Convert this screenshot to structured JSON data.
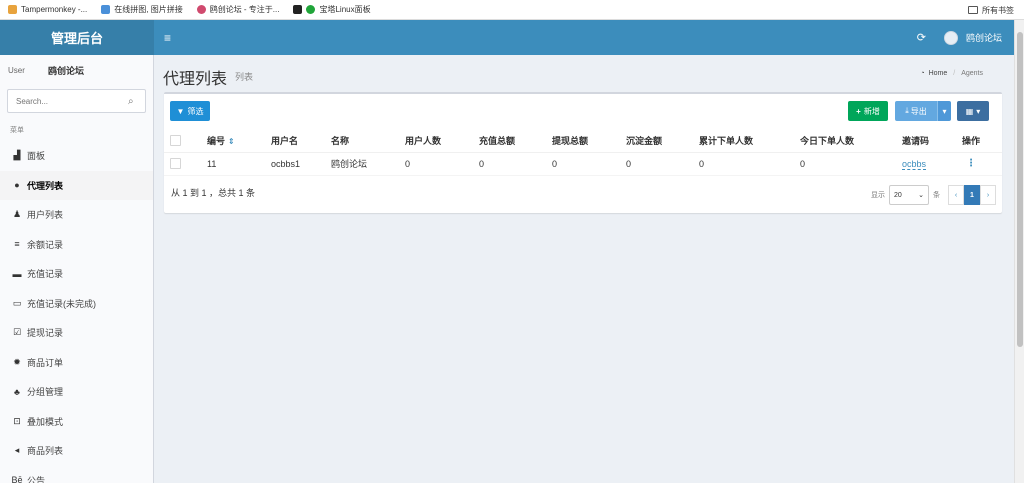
{
  "bookmarks": [
    {
      "label": "Tampermonkey -...",
      "color": "#e8a33d"
    },
    {
      "label": "在线拼图, 图片拼接",
      "color": "#4a90d9"
    },
    {
      "label": "鸥创论坛 - 专注于...",
      "color": "#d04a6e"
    },
    {
      "label": "宝塔Linux面板",
      "color": "#20a53a"
    }
  ],
  "bookmarks_folder": "所有书签",
  "header": {
    "logo": "管理后台",
    "menu_toggle": "≡",
    "username": "鸥创论坛"
  },
  "sidebar": {
    "user_image_alt": "User",
    "user_name": "鸥创论坛",
    "search_placeholder": "Search...",
    "menu_header": "菜单",
    "items": [
      {
        "label": "面板",
        "icon": "area-chart-icon"
      },
      {
        "label": "代理列表",
        "icon": "circle-icon"
      },
      {
        "label": "用户列表",
        "icon": "user-icon"
      },
      {
        "label": "余额记录",
        "icon": "bars-icon"
      },
      {
        "label": "充值记录",
        "icon": "credit-card-icon"
      },
      {
        "label": "充值记录(未完成)",
        "icon": "rectangle-icon"
      },
      {
        "label": "提现记录",
        "icon": "checkbox-icon"
      },
      {
        "label": "商品订单",
        "icon": "gear-icon"
      },
      {
        "label": "分组管理",
        "icon": "users-icon"
      },
      {
        "label": "叠加模式",
        "icon": "object-group-icon"
      },
      {
        "label": "商品列表",
        "icon": "list-icon"
      },
      {
        "label": "公告",
        "icon": "behance-icon"
      }
    ]
  },
  "page": {
    "title": "代理列表",
    "subtitle": "列表",
    "breadcrumb_home": "Home",
    "breadcrumb_current": "Agents"
  },
  "toolbar": {
    "filter": "筛选",
    "new": "新增",
    "export": "导出"
  },
  "table": {
    "columns": [
      "编号",
      "用户名",
      "名称",
      "用户人数",
      "充值总额",
      "提现总额",
      "沉淀金额",
      "累计下单人数",
      "今日下单人数",
      "邀请码",
      "操作"
    ],
    "rows": [
      {
        "id": "11",
        "username": "ocbbs1",
        "name": "鸥创论坛",
        "user_count": "0",
        "recharge_total": "0",
        "withdraw_total": "0",
        "deposit_amount": "0",
        "total_orders": "0",
        "today_orders": "0",
        "invite_code": "ocbbs"
      }
    ]
  },
  "footer": {
    "summary": "从 1 到 1 ，总共 1 条",
    "show_label": "显示",
    "per_page": "20",
    "per_page_unit": "条",
    "prev": "‹",
    "page": "1",
    "next": "›"
  }
}
